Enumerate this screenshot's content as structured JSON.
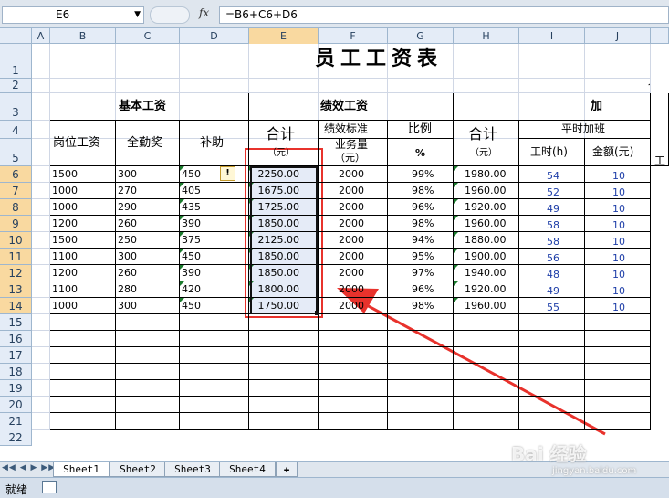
{
  "formula_bar": {
    "cell_ref": "E6",
    "fx_label": "fx",
    "formula": "=B6+C6+D6"
  },
  "columns": [
    "A",
    "B",
    "C",
    "D",
    "E",
    "F",
    "G",
    "H",
    "I",
    "J"
  ],
  "rows": [
    "1",
    "2",
    "3",
    "4",
    "5",
    "6",
    "7",
    "8",
    "9",
    "10",
    "11",
    "12",
    "13",
    "14",
    "15",
    "16",
    "17",
    "18",
    "19",
    "20",
    "21",
    "22"
  ],
  "sheet": {
    "title": "员工工资表",
    "row2_partial": "全",
    "group_basic": "基本工资",
    "group_perf": "绩效工资",
    "group_extra": "加",
    "h_post": "岗位工资",
    "h_attend": "全勤奖",
    "h_subsidy": "补助",
    "h_total1_a": "合计",
    "h_total1_b": "（元）",
    "h_perf_std": "绩效标准",
    "h_business": "业务量",
    "h_business_unit": "（元）",
    "h_ratio": "比例",
    "h_pct": "%",
    "h_total2_a": "合计",
    "h_total2_b": "（元）",
    "h_overtime": "平时加班",
    "h_hours": "工时(h)",
    "h_amount": "金额(元)",
    "h_k_partial": "工",
    "data": [
      [
        "1500",
        "300",
        "450",
        "2250.00",
        "2000",
        "99%",
        "1980.00",
        "54",
        "10"
      ],
      [
        "1000",
        "270",
        "405",
        "1675.00",
        "2000",
        "98%",
        "1960.00",
        "52",
        "10"
      ],
      [
        "1000",
        "290",
        "435",
        "1725.00",
        "2000",
        "96%",
        "1920.00",
        "49",
        "10"
      ],
      [
        "1200",
        "260",
        "390",
        "1850.00",
        "2000",
        "98%",
        "1960.00",
        "58",
        "10"
      ],
      [
        "1500",
        "250",
        "375",
        "2125.00",
        "2000",
        "94%",
        "1880.00",
        "58",
        "10"
      ],
      [
        "1100",
        "300",
        "450",
        "1850.00",
        "2000",
        "95%",
        "1900.00",
        "56",
        "10"
      ],
      [
        "1200",
        "260",
        "390",
        "1850.00",
        "2000",
        "97%",
        "1940.00",
        "48",
        "10"
      ],
      [
        "1100",
        "280",
        "420",
        "1800.00",
        "2000",
        "96%",
        "1920.00",
        "49",
        "10"
      ],
      [
        "1000",
        "300",
        "450",
        "1750.00",
        "2000",
        "98%",
        "1960.00",
        "55",
        "10"
      ]
    ]
  },
  "tabs": [
    "Sheet1",
    "Sheet2",
    "Sheet3",
    "Sheet4"
  ],
  "status": {
    "ready": "就绪"
  },
  "watermark": {
    "brand": "Bai 经验",
    "url": "jingyan.baidu.com"
  },
  "colors": {
    "annotation_red": "#e8322c",
    "selection_fill": "#e5ebf7",
    "header_bg": "#e4ecf7"
  }
}
